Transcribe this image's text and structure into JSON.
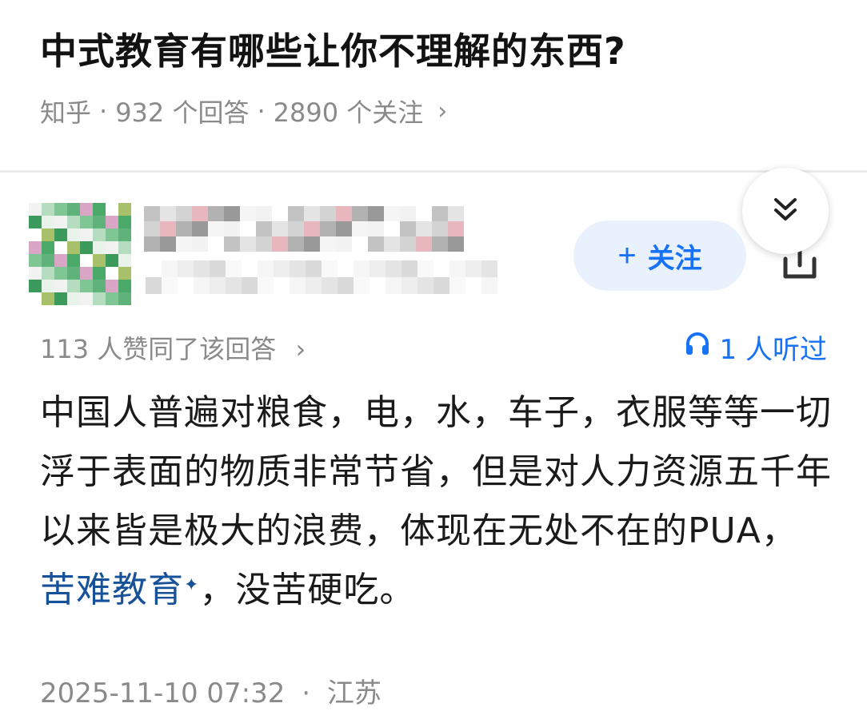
{
  "question": {
    "title": "中式教育有哪些让你不理解的东西?",
    "source": "知乎",
    "answers": "932 个回答",
    "followers": "2890 个关注",
    "separator": "·",
    "chevron": "›"
  },
  "author": {
    "avatar_icon": "avatar-pixelated",
    "follow_label": "关注",
    "follow_plus": "+",
    "share_icon": "share-icon",
    "collapse_icon": "double-chevron-down-icon"
  },
  "answer": {
    "votes": "113 人赞同了该回答",
    "votes_chevron": "›",
    "listen_icon": "headphones-icon",
    "listen_label": "1 人听过",
    "text_before_link": "中国人普遍对粮食，电，水，车子，衣服等等一切浮于表面的物质非常节省，但是对人力资源五千年以来皆是极大的浪费，体现在无处不在的PUA，",
    "link_text": "苦难教育",
    "link_mark": "✦",
    "text_after_link": "，没苦硬吃。",
    "date": "2025-11-10 07:32",
    "separator": "·",
    "location": "江苏"
  },
  "colors": {
    "accent": "#1772f6",
    "link": "#175199",
    "muted": "#8a8a8a",
    "follow_bg": "#e9f1fd"
  }
}
